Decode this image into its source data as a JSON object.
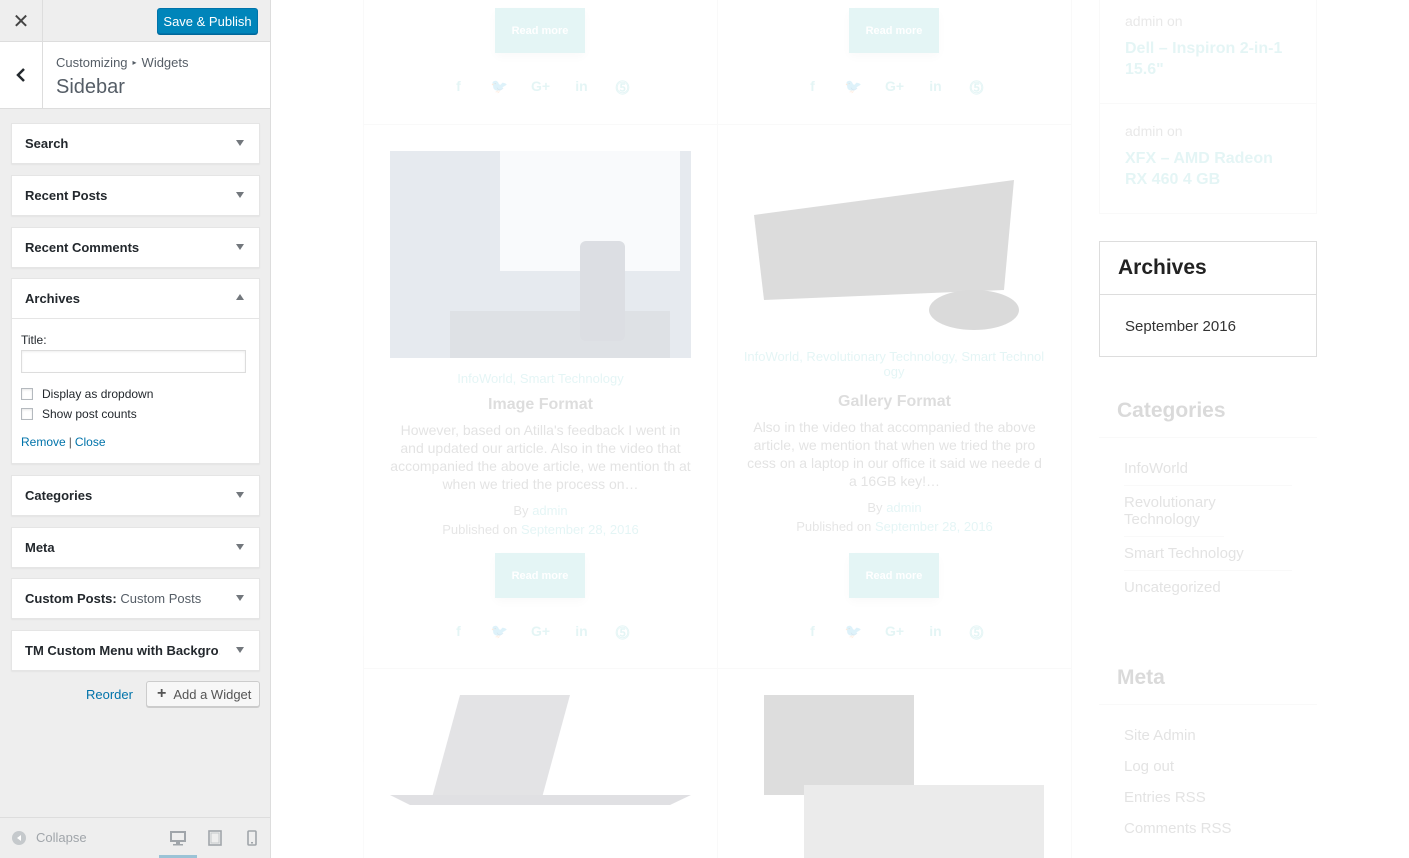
{
  "header": {
    "close_glyph": "✕",
    "publish_label": "Save & Publish"
  },
  "section": {
    "crumb_root": "Customizing",
    "crumb_sep": "▸",
    "crumb_child": "Widgets",
    "title": "Sidebar"
  },
  "widgets": [
    {
      "title": "Search",
      "sub": ""
    },
    {
      "title": "Recent Posts",
      "sub": ""
    },
    {
      "title": "Recent Comments",
      "sub": ""
    },
    {
      "title": "Archives",
      "sub": ""
    },
    {
      "title": "Categories",
      "sub": ""
    },
    {
      "title": "Meta",
      "sub": ""
    },
    {
      "title": "Custom Posts:",
      "sub": " Custom Posts"
    },
    {
      "title": "TM Custom Menu with Backgro…",
      "sub": ""
    }
  ],
  "archives_form": {
    "title_label": "Title:",
    "title_value": "",
    "dropdown_label": "Display as dropdown",
    "dropdown_checked": false,
    "counts_label": "Show post counts",
    "counts_checked": false,
    "remove_label": "Remove",
    "pipe": "|",
    "close_label": "Close"
  },
  "footer_actions": {
    "reorder_label": "Reorder",
    "add_plus": "+",
    "add_label": "Add a Widget"
  },
  "footer": {
    "collapse_label": "Collapse"
  },
  "preview": {
    "read_more": "Read more",
    "social": [
      "f",
      "🐦",
      "G+",
      "in",
      "⓹"
    ],
    "posts": [
      {
        "cats": "InfoWorld, Smart Technology",
        "title": "Image Format",
        "excerpt": "However, based on Atilla's feedback I went in and updated our article. Also in the video that accompanied the above article, we mention th at when we tried the process on…",
        "by": "By",
        "author": "admin",
        "published": "Published on",
        "date": "September 28, 2016"
      },
      {
        "cats": "InfoWorld, Revolutionary Technology, Smart Technol ogy",
        "title": "Gallery Format",
        "excerpt": "Also in the video that accompanied the above article, we mention that when we tried the pro cess on a laptop in our office it said we neede d a 16GB key!…",
        "by": "By",
        "author": "admin",
        "published": "Published on",
        "date": "September 28, 2016"
      }
    ],
    "recent": [
      {
        "by": "admin on",
        "title": "Dell – Inspiron 2-in-1 15.6\""
      },
      {
        "by": "admin on",
        "title": "XFX – AMD Radeon RX 460 4 GB"
      }
    ],
    "archives": {
      "heading": "Archives",
      "item": "September 2016"
    },
    "categories": {
      "heading": "Categories",
      "items": [
        "InfoWorld",
        "Revolutionary Technology",
        "Smart Technology",
        "Uncategorized"
      ]
    },
    "meta": {
      "heading": "Meta",
      "items": [
        "Site Admin",
        "Log out",
        "Entries RSS",
        "Comments RSS"
      ]
    }
  },
  "colors": {
    "primary_button": "#0085ba",
    "link": "#0073aa",
    "accent": "#5dc3c7",
    "panel_bg": "#eeeeee"
  }
}
